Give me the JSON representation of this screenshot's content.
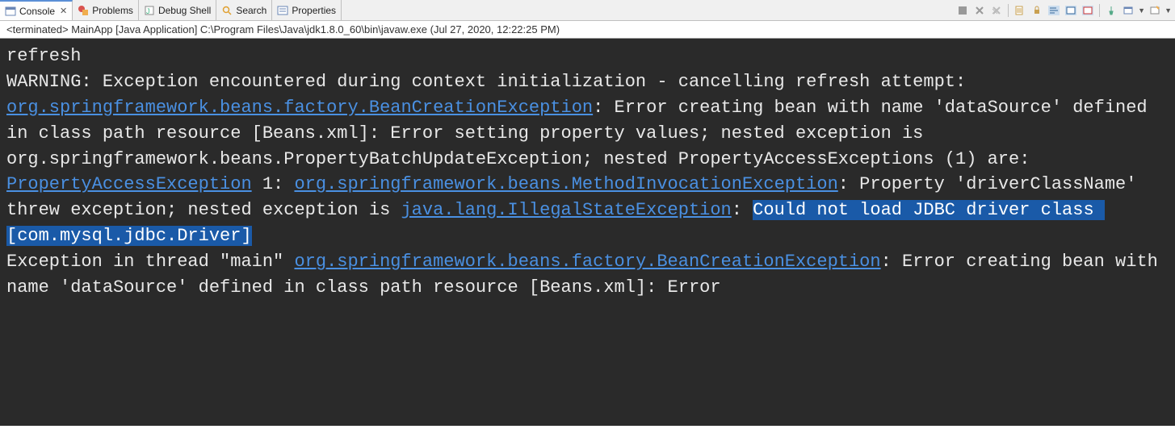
{
  "tabs": [
    {
      "label": "Console",
      "active": true,
      "icon": "console-icon",
      "closable": true
    },
    {
      "label": "Problems",
      "active": false,
      "icon": "problems-icon",
      "closable": false
    },
    {
      "label": "Debug Shell",
      "active": false,
      "icon": "debug-shell-icon",
      "closable": false
    },
    {
      "label": "Search",
      "active": false,
      "icon": "search-icon",
      "closable": false
    },
    {
      "label": "Properties",
      "active": false,
      "icon": "properties-icon",
      "closable": false
    }
  ],
  "status_line": "<terminated> MainApp [Java Application] C:\\Program Files\\Java\\jdk1.8.0_60\\bin\\javaw.exe (Jul 27, 2020, 12:22:25 PM)",
  "console": {
    "line1": "refresh",
    "warn_prefix": "WARNING: Exception encountered during context initialization - cancelling refresh attempt: ",
    "link1": "org.springframework.beans.factory.BeanCreationException",
    "after_link1": ": Error creating bean with name 'dataSource' defined in class path resource [Beans.xml]: Error setting property values; nested exception is org.springframework.beans.PropertyBatchUpdateException; nested PropertyAccessExceptions (1) are:",
    "newline_link2": "PropertyAccessException",
    "after_link2a": " 1: ",
    "link3": "org.springframework.beans.MethodInvocationException",
    "after_link3": ": Property 'driverClassName' threw exception; nested exception is ",
    "link4": "java.lang.IllegalStateException",
    "after_link4": ": ",
    "highlight": "Could not load JDBC driver class [com.mysql.jdbc.Driver]",
    "line_ex_prefix": "Exception in thread \"main\" ",
    "link5": "org.springframework.beans.factory.BeanCreationException",
    "after_link5": ": Error creating bean with name 'dataSource' defined in class path resource [Beans.xml]: Error"
  }
}
